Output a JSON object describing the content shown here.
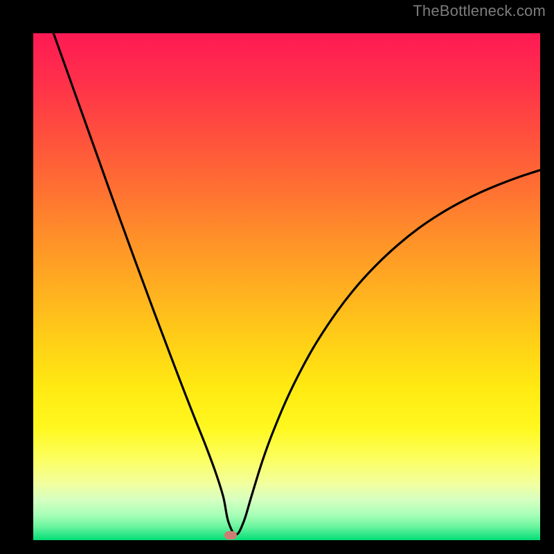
{
  "watermark": "TheBottleneck.com",
  "dot": {
    "x_percent": 39.0,
    "y_percent": 99.05
  },
  "colors": {
    "curve_stroke": "#000000",
    "dot_fill": "#cf7c74",
    "frame_bg": "#000000"
  },
  "chart_data": {
    "type": "line",
    "title": "",
    "xlabel": "",
    "ylabel": "",
    "xlim": [
      0,
      100
    ],
    "ylim": [
      0,
      100
    ],
    "annotations": [
      "TheBottleneck.com"
    ],
    "marker": {
      "x": 39,
      "y": 0.95
    },
    "series": [
      {
        "name": "bottleneck-curve",
        "x": [
          4,
          6,
          8,
          10,
          12,
          14,
          16,
          18,
          20,
          22,
          24,
          26,
          28,
          30,
          32,
          34,
          36,
          37.5,
          38.5,
          40,
          41.5,
          43,
          45,
          47,
          50,
          53,
          56,
          60,
          64,
          68,
          72,
          76,
          80,
          84,
          88,
          92,
          96,
          100
        ],
        "y": [
          100,
          94.4,
          88.8,
          83.2,
          77.6,
          72,
          66.4,
          60.9,
          55.4,
          50,
          44.6,
          39.3,
          34,
          28.8,
          23.7,
          18.7,
          13.3,
          8.5,
          3.6,
          1.1,
          3.6,
          8.5,
          15,
          20.6,
          27.8,
          33.9,
          39.2,
          45.2,
          50.3,
          54.6,
          58.3,
          61.5,
          64.2,
          66.5,
          68.5,
          70.2,
          71.7,
          73
        ]
      }
    ]
  }
}
